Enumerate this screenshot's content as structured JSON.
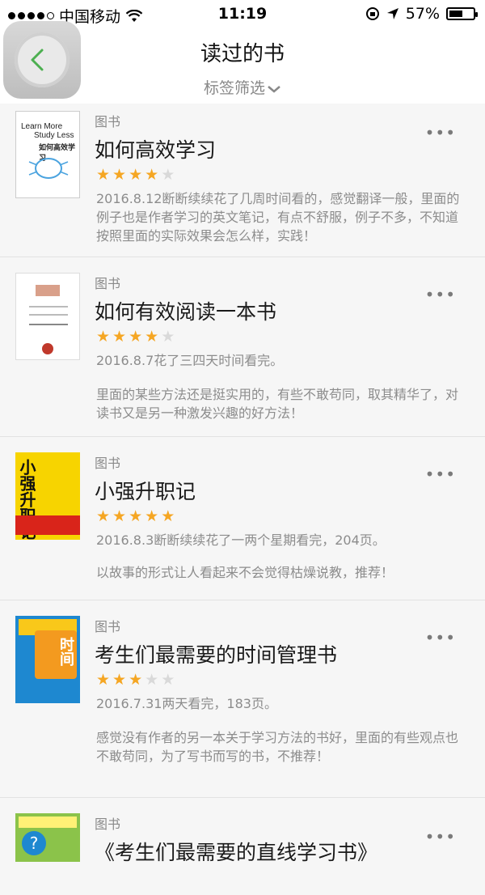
{
  "status_bar": {
    "carrier": "中国移动",
    "time": "11:19",
    "battery": "57%",
    "battery_level": 0.57
  },
  "header": {
    "title": "读过的书",
    "filter_label": "标签筛选",
    "filter_icon": "chevron-down-icon",
    "back_icon": "chevron-left-icon",
    "accent": "#4caf50"
  },
  "books": [
    {
      "category": "图书",
      "title": "如何高效学习",
      "rating": 4,
      "rating_max": 5,
      "cover_lines": [
        "Learn More",
        "Study Less",
        "如何高效学习"
      ],
      "note": "2016.8.12断断续续花了几周时间看的，感觉翻译一般，里面的例子也是作者学习的英文笔记，有点不舒服，例子不多，不知道按照里面的实际效果会怎么样，实践！"
    },
    {
      "category": "图书",
      "title": "如何有效阅读一本书",
      "rating": 4,
      "rating_max": 5,
      "note_date": "2016.8.7花了三四天时间看完。",
      "note": "里面的某些方法还是挺实用的，有些不敢苟同，取其精华了，对读书又是另一种激发兴趣的好方法！"
    },
    {
      "category": "图书",
      "title": "小强升职记",
      "rating": 5,
      "rating_max": 5,
      "cover_text": "小强升职记",
      "note_date": "2016.8.3断断续续花了一两个星期看完，204页。",
      "note": "以故事的形式让人看起来不会觉得枯燥说教，推荐！"
    },
    {
      "category": "图书",
      "title": "考生们最需要的时间管理书",
      "rating": 3,
      "rating_max": 5,
      "cover_text": "时间",
      "note_date": "2016.7.31两天看完，183页。",
      "note": "感觉没有作者的另一本关于学习方法的书好，里面的有些观点也不敢苟同，为了写书而写的书，不推荐！"
    },
    {
      "category": "图书",
      "title": "《考生们最需要的直线学习书》"
    }
  ],
  "colors": {
    "star_on": "#f5a623",
    "star_off": "#d9d9d9"
  }
}
